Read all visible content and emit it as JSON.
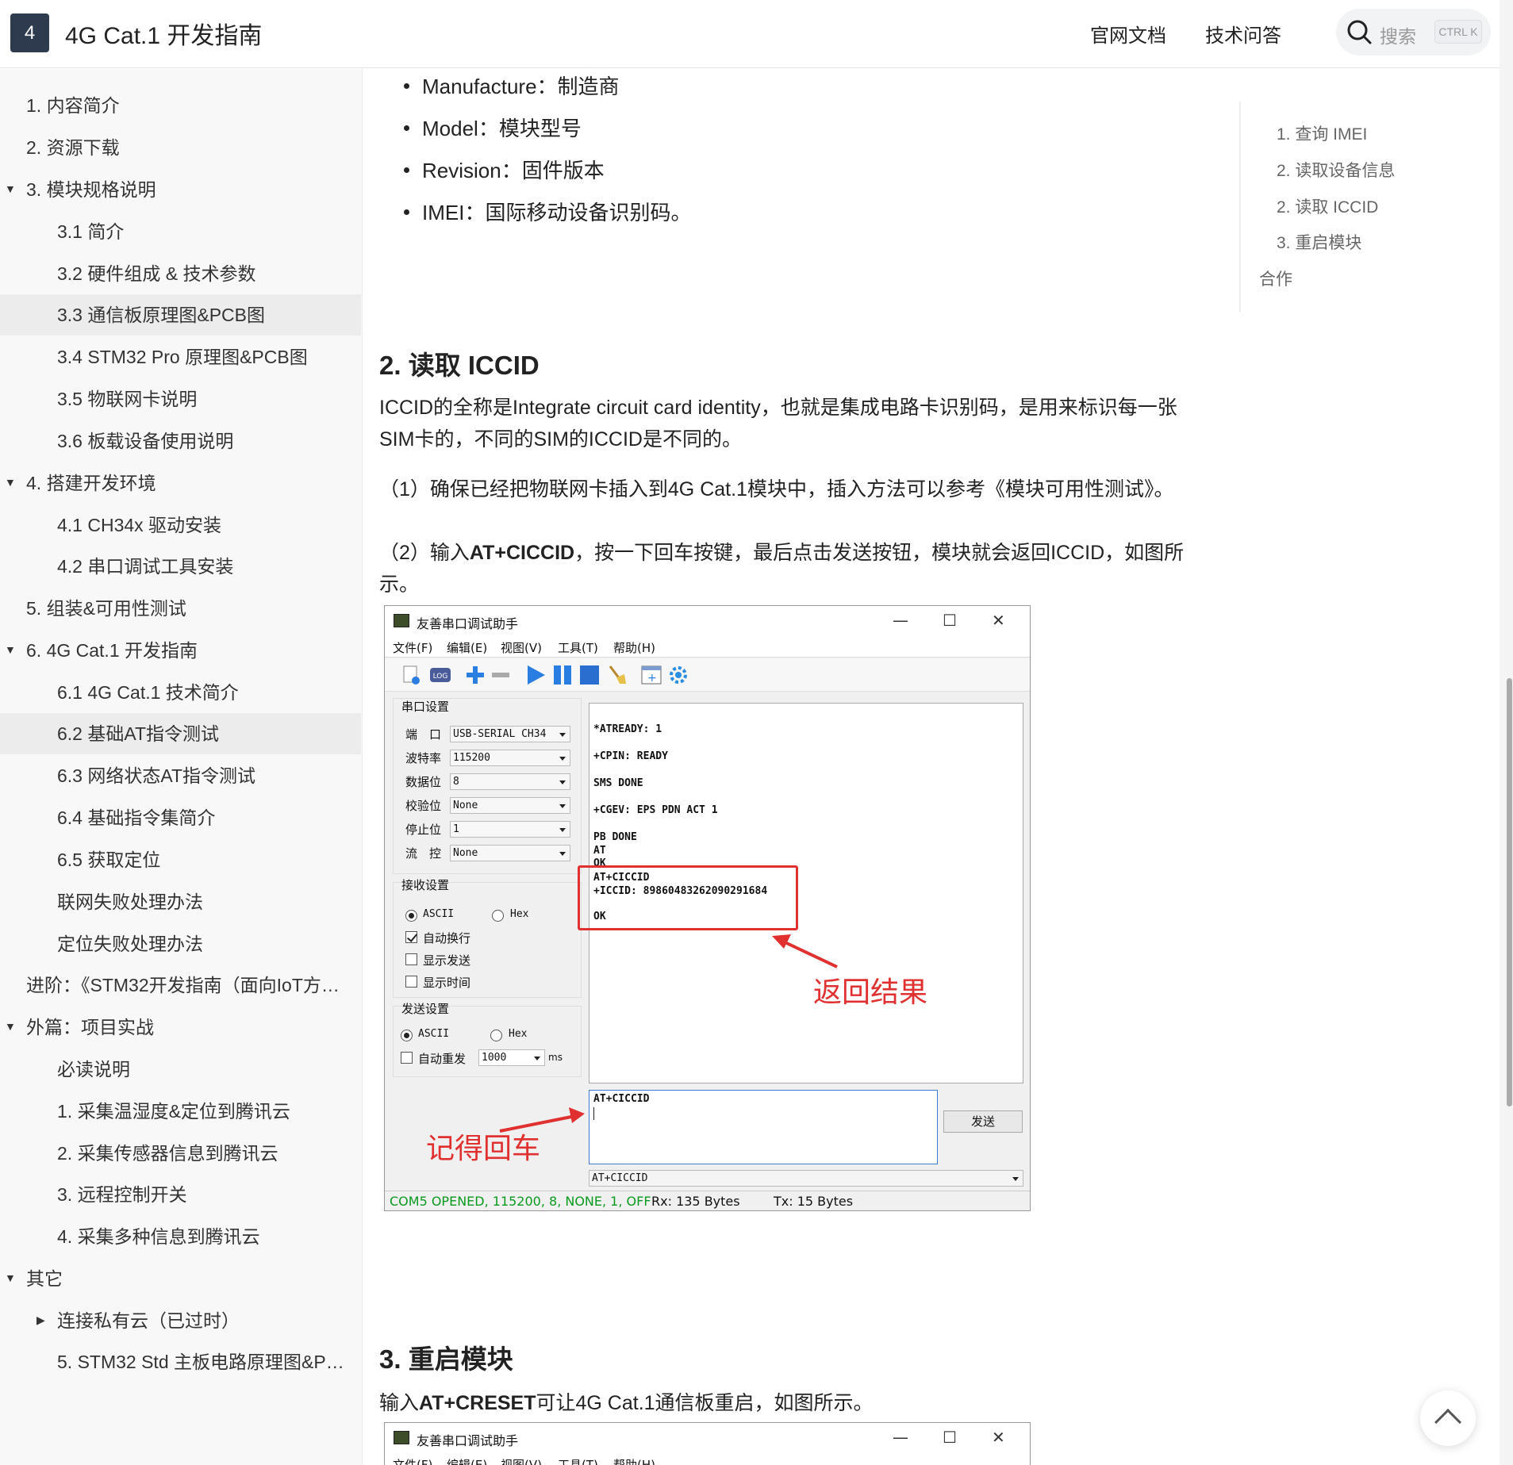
{
  "header": {
    "logo": "4",
    "title": "4G Cat.1 开发指南",
    "nav": [
      "官网文档",
      "技术问答"
    ],
    "search_placeholder": "搜索",
    "search_shortcut": "CTRL K"
  },
  "sidebar": {
    "items": [
      {
        "label": "1. 内容简介"
      },
      {
        "label": "2. 资源下载"
      },
      {
        "label": "3. 模块规格说明"
      },
      {
        "label": "3.1 简介"
      },
      {
        "label": "3.2 硬件组成 & 技术参数"
      },
      {
        "label": "3.3 通信板原理图&PCB图"
      },
      {
        "label": "3.4 STM32 Pro 原理图&PCB图"
      },
      {
        "label": "3.5 物联网卡说明"
      },
      {
        "label": "3.6 板载设备使用说明"
      },
      {
        "label": "4. 搭建开发环境"
      },
      {
        "label": "4.1 CH34x 驱动安装"
      },
      {
        "label": "4.2 串口调试工具安装"
      },
      {
        "label": "5. 组装&可用性测试"
      },
      {
        "label": "6. 4G Cat.1 开发指南"
      },
      {
        "label": "6.1 4G Cat.1 技术简介"
      },
      {
        "label": "6.2 基础AT指令测试"
      },
      {
        "label": "6.3 网络状态AT指令测试"
      },
      {
        "label": "6.4 基础指令集简介"
      },
      {
        "label": "6.5 获取定位"
      },
      {
        "label": "联网失败处理办法"
      },
      {
        "label": "定位失败处理办法"
      },
      {
        "label": "进阶：《STM32开发指南（面向IoT方…"
      },
      {
        "label": "外篇：项目实战"
      },
      {
        "label": "必读说明"
      },
      {
        "label": "1. 采集温湿度&定位到腾讯云"
      },
      {
        "label": "2. 采集传感器信息到腾讯云"
      },
      {
        "label": "3. 远程控制开关"
      },
      {
        "label": "4. 采集多种信息到腾讯云"
      },
      {
        "label": "其它"
      },
      {
        "label": "连接私有云（已过时）"
      },
      {
        "label": "5. STM32 Std 主板电路原理图&PC…"
      }
    ]
  },
  "main": {
    "bullets": [
      "Manufacture：制造商",
      "Model：模块型号",
      "Revision：固件版本",
      "IMEI：国际移动设备识别码。"
    ],
    "section2_title": "2. 读取 ICCID",
    "section2_p1": "ICCID的全称是Integrate circuit card identity，也就是集成电路卡识别码，是用来标识每一张SIM卡的，不同的SIM的ICCID是不同的。",
    "section2_p2": "（1）确保已经把物联网卡插入到4G Cat.1模块中，插入方法可以参考《模块可用性测试》。",
    "section2_p3_pre": "（2）输入",
    "section2_p3_bold": "AT+CICCID",
    "section2_p3_post": "，按一下回车按键，最后点击发送按钮，模块就会返回ICCID，如图所示。",
    "section3_title": "3. 重启模块",
    "section3_p1_pre": "输入",
    "section3_p1_bold": "AT+CRESET",
    "section3_p1_post": "可让4G Cat.1通信板重启，如图所示。"
  },
  "toc": {
    "items": [
      "1. 查询 IMEI",
      "2. 读取设备信息",
      "2. 读取 ICCID",
      "3. 重启模块",
      "合作"
    ]
  },
  "serial_tool": {
    "title": "友善串口调试助手",
    "window_buttons": [
      "—",
      "☐",
      "✕"
    ],
    "menu": [
      "文件(F)",
      "编辑(E)",
      "视图(V)",
      "工具(T)",
      "帮助(H)"
    ],
    "port_group": "串口设置",
    "port_rows": [
      {
        "label": "端　口",
        "value": "USB-SERIAL CH34"
      },
      {
        "label": "波特率",
        "value": "115200"
      },
      {
        "label": "数据位",
        "value": "8"
      },
      {
        "label": "校验位",
        "value": "None"
      },
      {
        "label": "停止位",
        "value": "1"
      },
      {
        "label": "流　控",
        "value": "None"
      }
    ],
    "recv_group": "接收设置",
    "recv_ascii": "ASCII",
    "recv_hex": "Hex",
    "recv_opts": [
      "自动换行",
      "显示发送",
      "显示时间"
    ],
    "send_group": "发送设置",
    "send_ascii": "ASCII",
    "send_hex": "Hex",
    "auto_resend": "自动重发",
    "resend_value": "1000",
    "resend_unit": "ms",
    "rx_lines": [
      "*ATREADY: 1",
      "+CPIN: READY",
      "SMS DONE",
      "+CGEV: EPS PDN ACT 1",
      "PB DONE",
      "AT",
      "OK",
      "AT+CICCID",
      "+ICCID: 89860483262090291684",
      "OK"
    ],
    "send_text": "AT+CICCID",
    "send_button": "发送",
    "history_value": "AT+CICCID",
    "status_port": "COM5 OPENED, 115200, 8, NONE, 1, OFF",
    "status_rx": "Rx: 135 Bytes",
    "status_tx": "Tx: 15 Bytes",
    "annotation_result": "返回结果",
    "annotation_enter": "记得回车"
  },
  "colors": {
    "accent": "#2e3b4e",
    "annotation": "#e03030",
    "status_green": "#0a9a1e"
  }
}
